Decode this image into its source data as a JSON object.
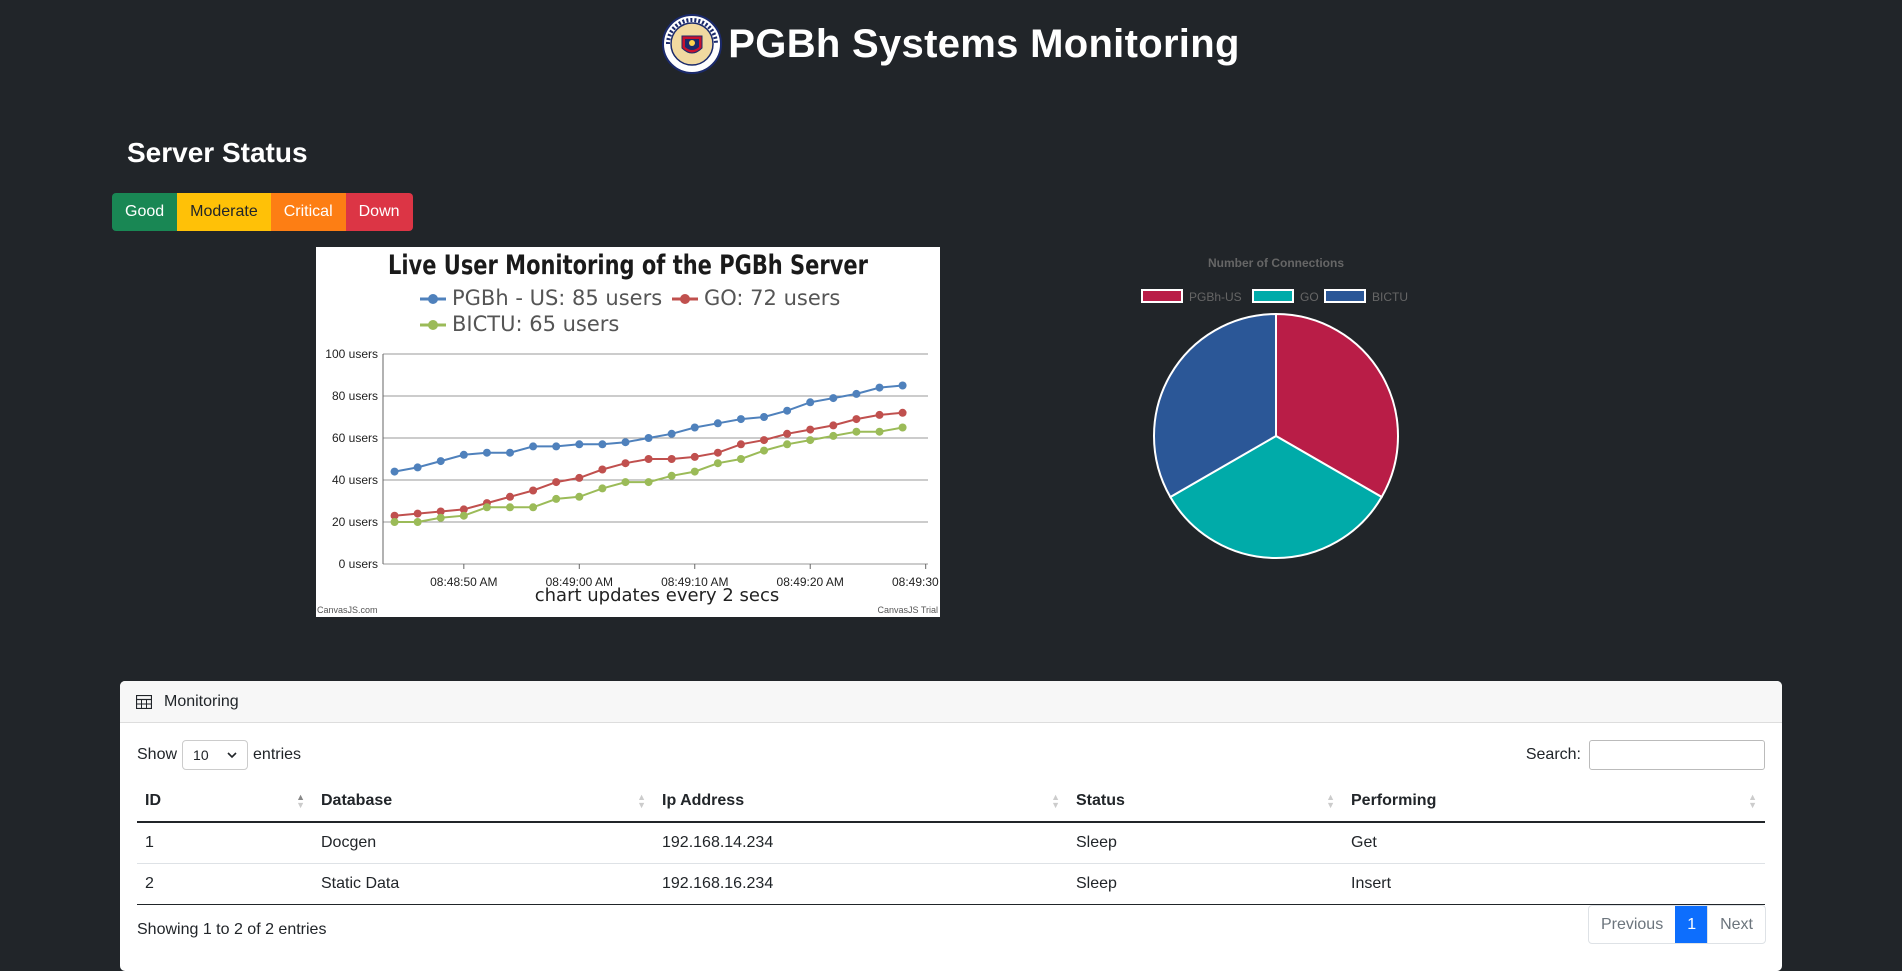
{
  "header": {
    "title": "PGBh Systems Monitoring",
    "seal_top_text": "PROVINCE OF BOHOL",
    "seal_bottom_text": "OFFICIAL SEAL"
  },
  "status": {
    "title": "Server Status",
    "levels": [
      {
        "label": "Good",
        "color": "#198754"
      },
      {
        "label": "Moderate",
        "color": "#ffc107"
      },
      {
        "label": "Critical",
        "color": "#fd7e14"
      },
      {
        "label": "Down",
        "color": "#dc3545"
      }
    ]
  },
  "chart_data": [
    {
      "type": "line",
      "title": "Live User Monitoring of the PGBh Server",
      "subtitle": "chart updates every 2 secs",
      "ylim": [
        0,
        100
      ],
      "y_ticks": [
        "0 users",
        "20 users",
        "40 users",
        "60 users",
        "80 users",
        "100 users"
      ],
      "x_ticks": [
        "08:48:50 AM",
        "08:49:00 AM",
        "08:49:10 AM",
        "08:49:20 AM",
        "08:49:30 AM"
      ],
      "x_start_seconds": 44,
      "x_step_seconds": 2,
      "grid": true,
      "legend": "top",
      "credit_left": "CanvasJS.com",
      "credit_right": "CanvasJS Trial",
      "series": [
        {
          "name": "PGBh - US",
          "legend": "PGBh - US: 85 users",
          "color": "#4f81bc",
          "values": [
            44,
            46,
            49,
            52,
            53,
            53,
            56,
            56,
            57,
            57,
            58,
            60,
            62,
            65,
            67,
            69,
            70,
            73,
            77,
            79,
            81,
            84,
            85
          ]
        },
        {
          "name": "GO",
          "legend": "GO: 72 users",
          "color": "#c0504e",
          "values": [
            23,
            24,
            25,
            26,
            29,
            32,
            35,
            39,
            41,
            45,
            48,
            50,
            50,
            51,
            53,
            57,
            59,
            62,
            64,
            66,
            69,
            71,
            72
          ]
        },
        {
          "name": "BICTU",
          "legend": "BICTU: 65 users",
          "color": "#9bbb58",
          "values": [
            20,
            20,
            22,
            23,
            27,
            27,
            27,
            31,
            32,
            36,
            39,
            39,
            42,
            44,
            48,
            50,
            54,
            57,
            59,
            61,
            63,
            63,
            65
          ]
        }
      ]
    },
    {
      "type": "pie",
      "title": "Number of Connections",
      "legend": "top",
      "categories": [
        "PGBh-US",
        "GO",
        "BICTU"
      ],
      "values": [
        1,
        1,
        1
      ],
      "colors": [
        "#b91d47",
        "#00aba9",
        "#2b5797"
      ]
    }
  ],
  "table_card": {
    "title": "Monitoring",
    "show_label": "Show",
    "entries_label": "entries",
    "page_length": "10",
    "search_label": "Search:",
    "search_value": "",
    "columns": [
      "ID",
      "Database",
      "Ip Address",
      "Status",
      "Performing"
    ],
    "rows": [
      [
        "1",
        "Docgen",
        "192.168.14.234",
        "Sleep",
        "Get"
      ],
      [
        "2",
        "Static Data",
        "192.168.16.234",
        "Sleep",
        "Insert"
      ]
    ],
    "info": "Showing 1 to 2 of 2 entries",
    "pagination": {
      "previous": "Previous",
      "current": "1",
      "next": "Next"
    }
  }
}
